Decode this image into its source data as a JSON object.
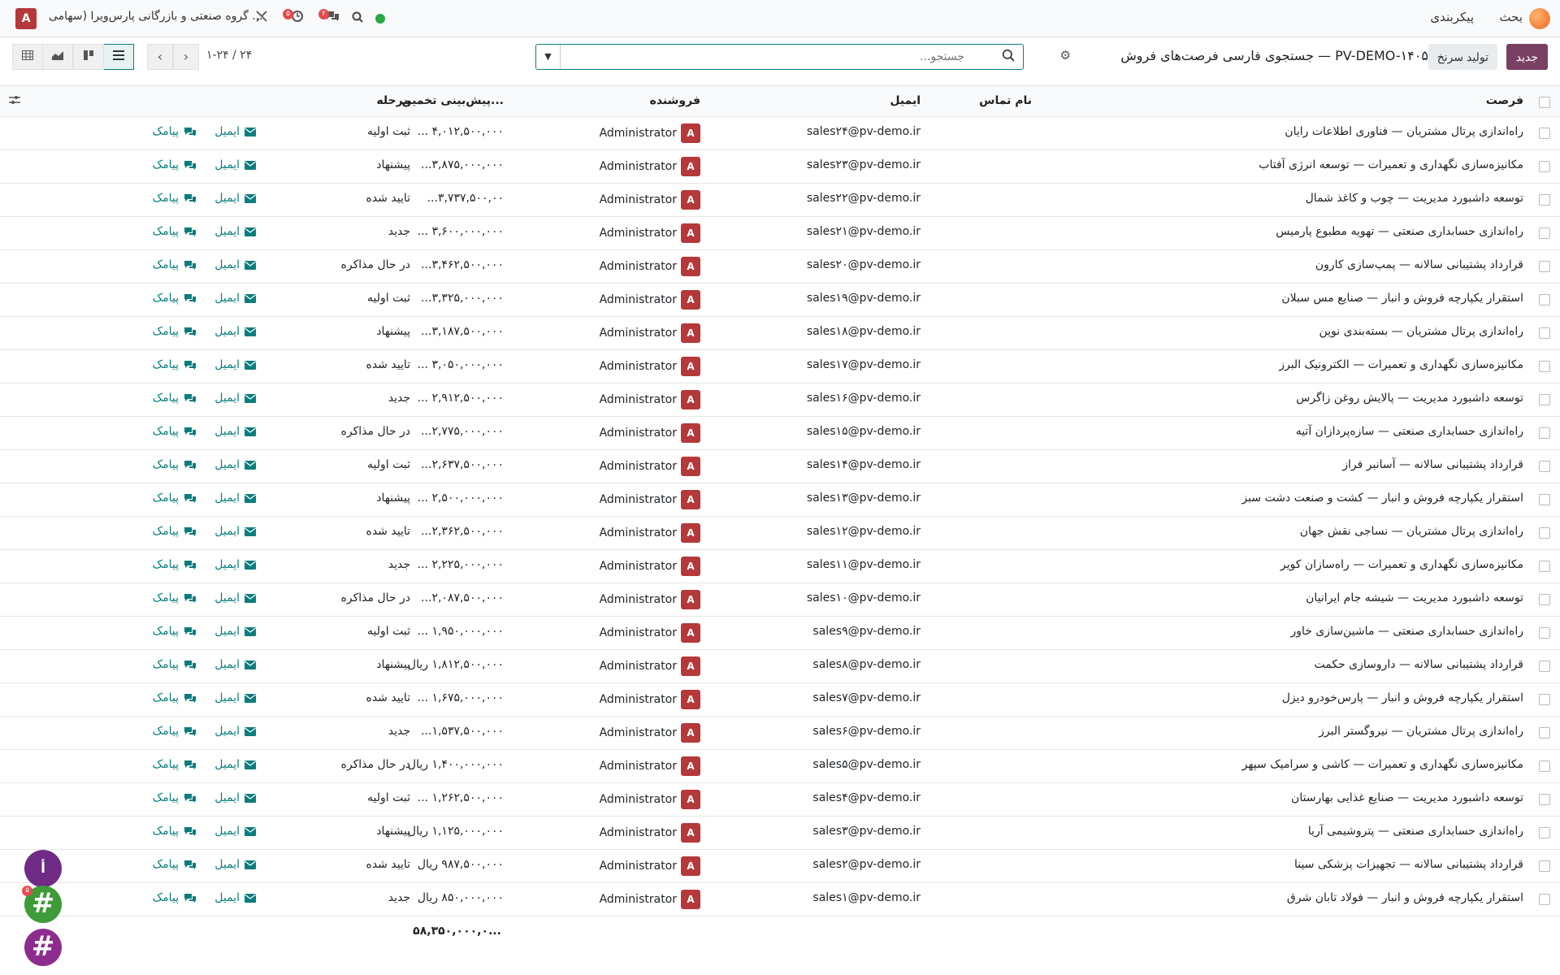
{
  "navbar": {
    "menu": [
      "بحث",
      "پیکربندی"
    ],
    "company": "گروه صنعتی و بازرگانی پارس‌ویرا (سهامی ...",
    "user_initial": "A",
    "activity_badge": "۵",
    "messages_badge": "۲"
  },
  "control": {
    "new_button": "جدید",
    "generate_button": "تولید سرنخ",
    "breadcrumb": "جستجوی فارسی فرصت‌های فروش — PV-DEMO-۱۴۰۵",
    "search_placeholder": "جستجو...",
    "pager": "۱-۲۴ / ۲۴"
  },
  "table": {
    "columns": {
      "opportunity": "فرصت",
      "contact": "نام تماس",
      "email": "ایمیل",
      "salesperson": "فروشنده",
      "expected_revenue": "پیش‌بینی تخمین...",
      "stage": "مرحله"
    },
    "action_email": "ایمیل",
    "action_sms": "پیامک",
    "rows": [
      {
        "opp": "راه‌اندازی پرتال مشتریان — فناوری اطلاعات رایان",
        "email": "sales۲۴@pv-demo.ir",
        "sp": "Administrator",
        "rev": "۴,۰۱۲,۵۰۰,۰۰۰ ...",
        "stage": "ثبت اولیه"
      },
      {
        "opp": "مکانیزه‌سازی نگهداری و تعمیرات — توسعه انرژی آفتاب",
        "email": "sales۲۳@pv-demo.ir",
        "sp": "Administrator",
        "rev": "۳,۸۷۵,۰۰۰,۰۰۰...",
        "stage": "پیشنهاد"
      },
      {
        "opp": "توسعه داشبورد مدیریت — چوب و کاغذ شمال",
        "email": "sales۲۲@pv-demo.ir",
        "sp": "Administrator",
        "rev": "۳,۷۳۷,۵۰۰,۰۰...",
        "stage": "تایید شده"
      },
      {
        "opp": "راه‌اندازی حسابداری صنعتی — تهویه مطبوع پارمیس",
        "email": "sales۲۱@pv-demo.ir",
        "sp": "Administrator",
        "rev": "۳,۶۰۰,۰۰۰,۰۰۰ ...",
        "stage": "جدید"
      },
      {
        "opp": "قرارداد پشتیبانی سالانه — پمپ‌سازی کارون",
        "email": "sales۲۰@pv-demo.ir",
        "sp": "Administrator",
        "rev": "۳,۴۶۲,۵۰۰,۰۰۰...",
        "stage": "در حال مذاکره"
      },
      {
        "opp": "استقرار یکپارچه فروش و انبار — صنایع مس سبلان",
        "email": "sales۱۹@pv-demo.ir",
        "sp": "Administrator",
        "rev": "۳,۳۲۵,۰۰۰,۰۰۰...",
        "stage": "ثبت اولیه"
      },
      {
        "opp": "راه‌اندازی پرتال مشتریان — بسته‌بندی نوین",
        "email": "sales۱۸@pv-demo.ir",
        "sp": "Administrator",
        "rev": "۳,۱۸۷,۵۰۰,۰۰۰...",
        "stage": "پیشنهاد"
      },
      {
        "opp": "مکانیزه‌سازی نگهداری و تعمیرات — الکترونیک البرز",
        "email": "sales۱۷@pv-demo.ir",
        "sp": "Administrator",
        "rev": "۳,۰۵۰,۰۰۰,۰۰۰ ...",
        "stage": "تایید شده"
      },
      {
        "opp": "توسعه داشبورد مدیریت — پالایش روغن زاگرس",
        "email": "sales۱۶@pv-demo.ir",
        "sp": "Administrator",
        "rev": "۲,۹۱۲,۵۰۰,۰۰۰ ...",
        "stage": "جدید"
      },
      {
        "opp": "راه‌اندازی حسابداری صنعتی — سازه‌پردازان آتیه",
        "email": "sales۱۵@pv-demo.ir",
        "sp": "Administrator",
        "rev": "۲,۷۷۵,۰۰۰,۰۰۰...",
        "stage": "در حال مذاکره"
      },
      {
        "opp": "قرارداد پشتیبانی سالانه — آسانبر فراز",
        "email": "sales۱۴@pv-demo.ir",
        "sp": "Administrator",
        "rev": "۲,۶۳۷,۵۰۰,۰۰۰...",
        "stage": "ثبت اولیه"
      },
      {
        "opp": "استقرار یکپارچه فروش و انبار — کشت و صنعت دشت سبز",
        "email": "sales۱۳@pv-demo.ir",
        "sp": "Administrator",
        "rev": "۲,۵۰۰,۰۰۰,۰۰۰ ...",
        "stage": "پیشنهاد"
      },
      {
        "opp": "راه‌اندازی پرتال مشتریان — نساجی نقش جهان",
        "email": "sales۱۲@pv-demo.ir",
        "sp": "Administrator",
        "rev": "۲,۳۶۲,۵۰۰,۰۰۰...",
        "stage": "تایید شده"
      },
      {
        "opp": "مکانیزه‌سازی نگهداری و تعمیرات — راه‌سازان کویر",
        "email": "sales۱۱@pv-demo.ir",
        "sp": "Administrator",
        "rev": "۲,۲۲۵,۰۰۰,۰۰۰ ...",
        "stage": "جدید"
      },
      {
        "opp": "توسعه داشبورد مدیریت — شیشه جام ایرانیان",
        "email": "sales۱۰@pv-demo.ir",
        "sp": "Administrator",
        "rev": "۲,۰۸۷,۵۰۰,۰۰۰...",
        "stage": "در حال مذاکره"
      },
      {
        "opp": "راه‌اندازی حسابداری صنعتی — ماشین‌سازی خاور",
        "email": "sales۹@pv-demo.ir",
        "sp": "Administrator",
        "rev": "۱,۹۵۰,۰۰۰,۰۰۰ ...",
        "stage": "ثبت اولیه"
      },
      {
        "opp": "قرارداد پشتیبانی سالانه — داروسازی حکمت",
        "email": "sales۸@pv-demo.ir",
        "sp": "Administrator",
        "rev": "۱,۸۱۲,۵۰۰,۰۰۰ ریال",
        "stage": "پیشنهاد"
      },
      {
        "opp": "استقرار یکپارچه فروش و انبار — پارس‌خودرو دیزل",
        "email": "sales۷@pv-demo.ir",
        "sp": "Administrator",
        "rev": "۱,۶۷۵,۰۰۰,۰۰۰ ...",
        "stage": "تایید شده"
      },
      {
        "opp": "راه‌اندازی پرتال مشتریان — نیروگستر البرز",
        "email": "sales۶@pv-demo.ir",
        "sp": "Administrator",
        "rev": "۱,۵۳۷,۵۰۰,۰۰۰...",
        "stage": "جدید"
      },
      {
        "opp": "مکانیزه‌سازی نگهداری و تعمیرات — کاشی و سرامیک سپهر",
        "email": "sales۵@pv-demo.ir",
        "sp": "Administrator",
        "rev": "۱,۴۰۰,۰۰۰,۰۰۰ ریال",
        "stage": "در حال مذاکره"
      },
      {
        "opp": "توسعه داشبورد مدیریت — صنایع غذایی بهارستان",
        "email": "sales۴@pv-demo.ir",
        "sp": "Administrator",
        "rev": "۱,۲۶۲,۵۰۰,۰۰۰ ...",
        "stage": "ثبت اولیه"
      },
      {
        "opp": "راه‌اندازی حسابداری صنعتی — پتروشیمی آریا",
        "email": "sales۳@pv-demo.ir",
        "sp": "Administrator",
        "rev": "۱,۱۲۵,۰۰۰,۰۰۰ ریال",
        "stage": "پیشنهاد"
      },
      {
        "opp": "قرارداد پشتیبانی سالانه — تجهیزات پزشکی سینا",
        "email": "sales۲@pv-demo.ir",
        "sp": "Administrator",
        "rev": "۹۸۷,۵۰۰,۰۰۰ ریال",
        "stage": "تایید شده"
      },
      {
        "opp": "استقرار یکپارچه فروش و انبار — فولاد تابان شرق",
        "email": "sales۱@pv-demo.ir",
        "sp": "Administrator",
        "rev": "۸۵۰,۰۰۰,۰۰۰ ریال",
        "stage": "جدید"
      }
    ],
    "total": "۵۸,۳۵۰,۰۰۰,۰..."
  },
  "chat": {
    "bubble1": "أ",
    "bubble2": "#",
    "bubble3": "#",
    "bubble2_badge": "۵"
  },
  "colors": {
    "brand": "#7a4064",
    "accent": "#0b7d7d",
    "avatar": "#b5383a"
  }
}
